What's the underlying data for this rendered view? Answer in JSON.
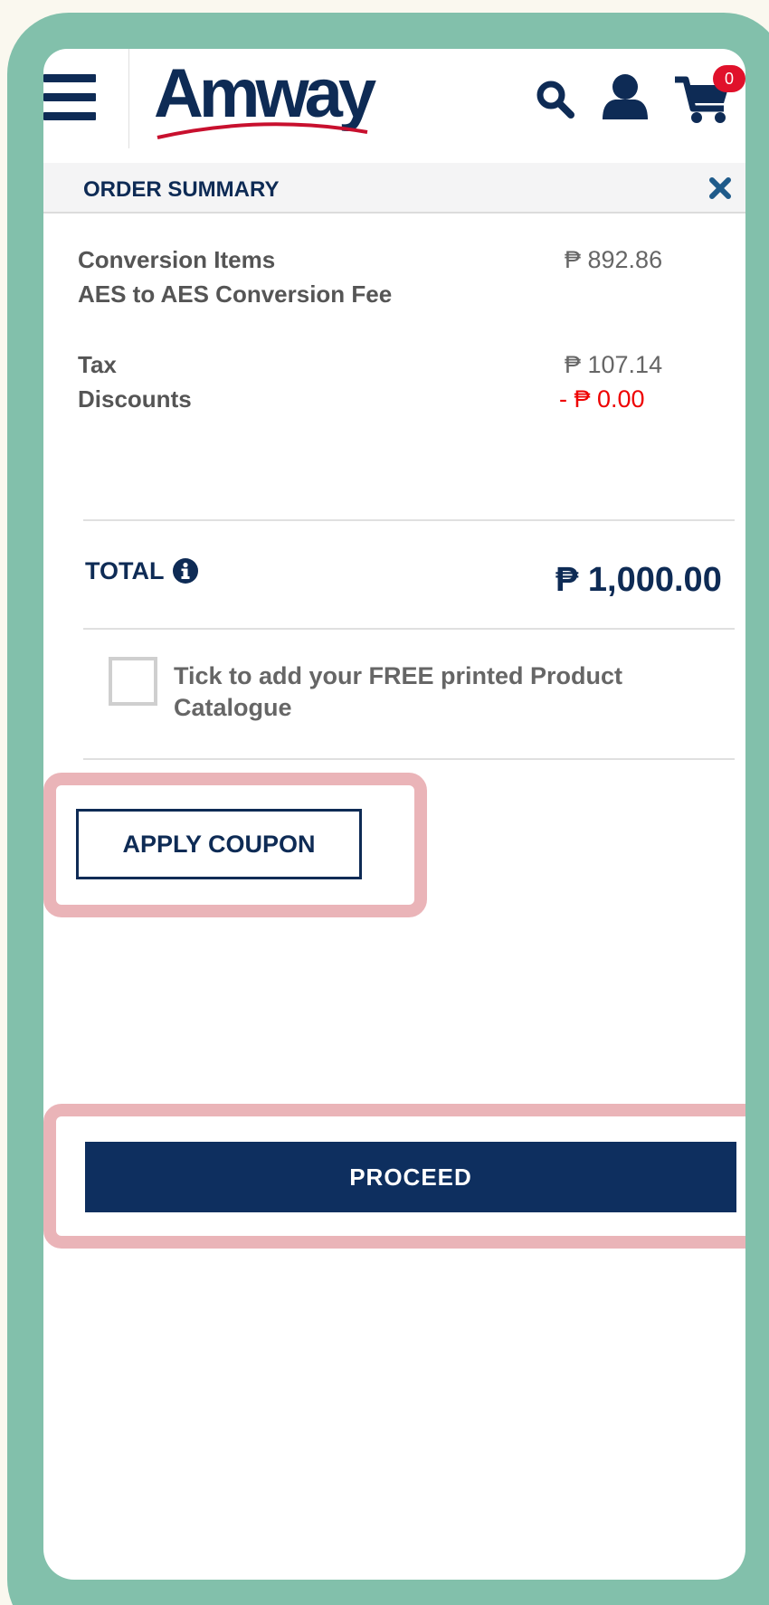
{
  "header": {
    "logo_text": "Amway",
    "cart_count": "0",
    "icons": [
      "menu-icon",
      "search-icon",
      "user-icon",
      "cart-icon"
    ]
  },
  "summary": {
    "title": "ORDER SUMMARY",
    "items": [
      {
        "label": "Conversion Items",
        "value": "₱ 892.86"
      },
      {
        "label": "AES to AES Conversion Fee",
        "value": ""
      },
      {
        "label": "Tax",
        "value": "₱ 107.14"
      },
      {
        "label": "Discounts",
        "value": "- ₱ 0.00"
      }
    ],
    "total_label": "TOTAL",
    "total_value": "₱ 1,000.00",
    "catalogue_checkbox_label": "Tick to add your FREE printed Product Catalogue",
    "catalogue_checked": false
  },
  "actions": {
    "apply_coupon_label": "APPLY COUPON",
    "proceed_label": "PROCEED"
  },
  "colors": {
    "brand_navy": "#0e2b55",
    "discount_red": "#ee0000",
    "badge_red": "#e0112b",
    "frame_green": "#82c0ab",
    "highlight_pink": "#eab4b8"
  }
}
